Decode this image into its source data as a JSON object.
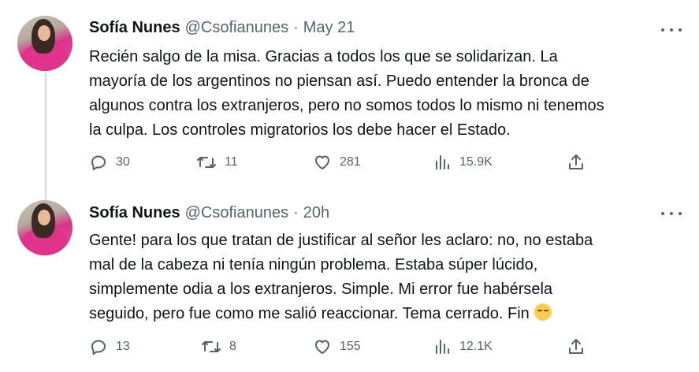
{
  "tweets": [
    {
      "display_name": "Sofía Nunes",
      "handle": "@Csofianunes",
      "separator": "·",
      "time": "May 21",
      "text_lines": [
        "Recién salgo de la misa. Gracias a todos los que se solidarizan. La",
        "mayoría de los argentinos no piensan así. Puedo entender la bronca de",
        "algunos contra los extranjeros, pero no somos todos lo mismo ni tenemos",
        "la culpa. Los controles migratorios los debe hacer el Estado."
      ],
      "replies": "30",
      "retweets": "11",
      "likes": "281",
      "views": "15.9K"
    },
    {
      "display_name": "Sofía Nunes",
      "handle": "@Csofianunes",
      "separator": "·",
      "time": "20h",
      "text_lines": [
        "Gente! para los que tratan de justificar al señor les aclaro: no, no estaba",
        "mal de la cabeza ni tenía ningún problema. Estaba súper lúcido,",
        "simplemente odia a los extranjeros. Simple. Mi error fue habérsela",
        "seguido, pero fue como me salió reaccionar. Tema cerrado. Fin"
      ],
      "emoji": "pensive-face-emoji",
      "replies": "13",
      "retweets": "8",
      "likes": "155",
      "views": "12.1K"
    }
  ],
  "icons": {
    "reply": "reply-icon",
    "retweet": "retweet-icon",
    "like": "heart-icon",
    "views": "views-chart-icon",
    "share": "share-icon",
    "more": "more-dots-icon"
  },
  "colors": {
    "text": "#0f1419",
    "secondary": "#536471",
    "thread_line": "#cfd9de"
  }
}
